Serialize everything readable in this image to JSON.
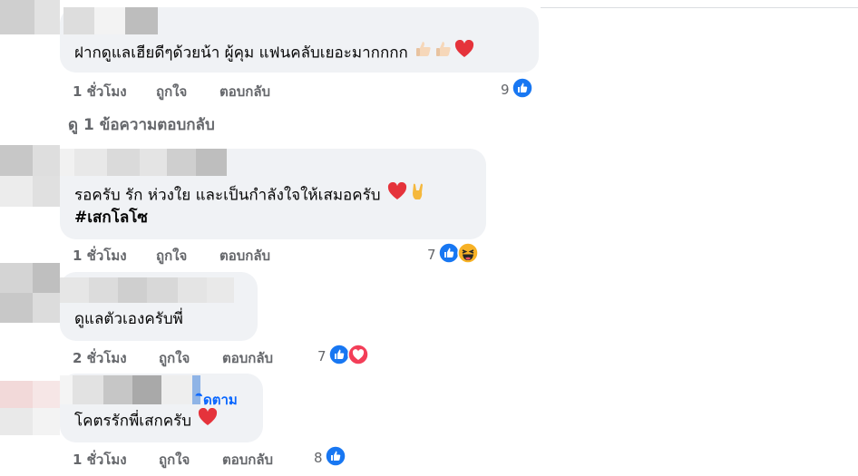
{
  "colors": {
    "bubble": "#f0f2f5",
    "meta": "#65676b",
    "like": "#1877f2",
    "love": "#f33e58",
    "link": "#0866ff"
  },
  "comments": [
    {
      "text": "ฝากดูแลเฮียดีๆด้วยน้า ผู้คุม แฟนคลับเยอะมากกกก",
      "emojis": [
        "thumbs-up-icon",
        "thumbs-up-icon",
        "red-heart-icon"
      ],
      "meta": {
        "time": "1 ชั่วโมง",
        "like": "ถูกใจ",
        "reply": "ตอบกลับ"
      },
      "reactions": {
        "count": "9",
        "types": [
          "like"
        ]
      },
      "view_replies": "ดู 1 ข้อความตอบกลับ"
    },
    {
      "text": "รอครับ รัก ห่วงใย และเป็นกำลังใจให้เสมอครับ",
      "hashtag": "#เสกโลโซ",
      "emojis": [
        "red-heart-icon",
        "rock-on-hand-icon"
      ],
      "meta": {
        "time": "1 ชั่วโมง",
        "like": "ถูกใจ",
        "reply": "ตอบกลับ"
      },
      "reactions": {
        "count": "7",
        "types": [
          "like",
          "haha"
        ]
      }
    },
    {
      "text": "ดูแลตัวเองครับพี่",
      "meta": {
        "time": "2 ชั่วโมง",
        "like": "ถูกใจ",
        "reply": "ตอบกลับ"
      },
      "reactions": {
        "count": "7",
        "types": [
          "like",
          "love"
        ]
      }
    },
    {
      "text": "โคตรรักพี่เสกครับ",
      "follow_label": "ิดตาม",
      "emojis": [
        "red-heart-icon"
      ],
      "meta": {
        "time": "1 ชั่วโมง",
        "like": "ถูกใจ",
        "reply": "ตอบกลับ"
      },
      "reactions": {
        "count": "8",
        "types": [
          "like"
        ]
      }
    }
  ]
}
